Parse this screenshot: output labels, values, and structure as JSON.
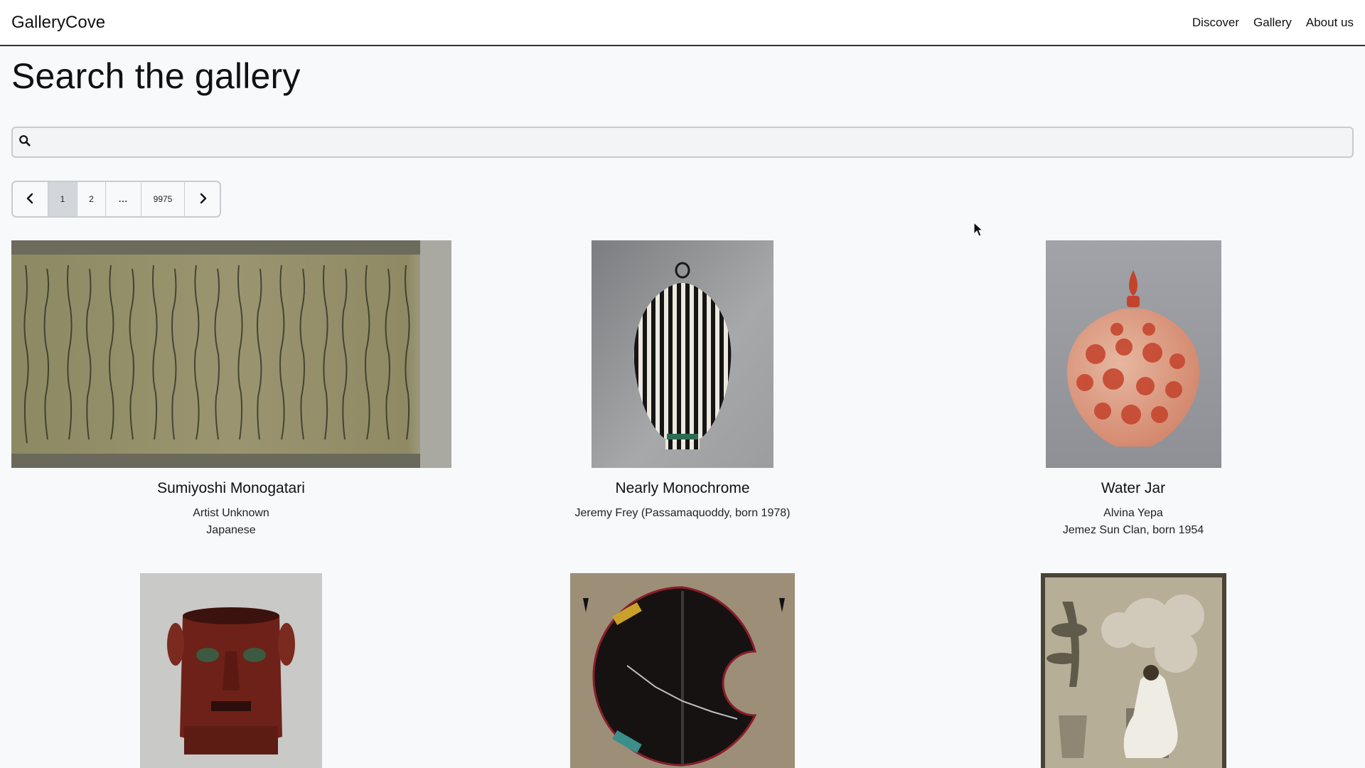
{
  "app": {
    "brand": "GalleryCove",
    "nav": [
      "Discover",
      "Gallery",
      "About us"
    ]
  },
  "page": {
    "title": "Search the gallery"
  },
  "search": {
    "placeholder": "",
    "value": "",
    "icon": "search-icon"
  },
  "pagination": {
    "prev_icon": "chevron-left-icon",
    "pages": [
      "1",
      "2",
      "...",
      "9975"
    ],
    "active": "1",
    "next_icon": "chevron-right-icon"
  },
  "results": [
    {
      "title": "Sumiyoshi Monogatari",
      "line1": "Artist Unknown",
      "line2": "Japanese"
    },
    {
      "title": "Nearly Monochrome",
      "line1": "Jeremy Frey (Passamaquoddy, born 1978)",
      "line2": ""
    },
    {
      "title": "Water Jar",
      "line1": "Alvina Yepa",
      "line2": "Jemez Sun Clan, born 1954"
    }
  ],
  "colors": {
    "background": "#f7f9fb",
    "header_bg": "#ffffff",
    "active_page": "#d3d6db",
    "border": "#c8cbd0"
  }
}
